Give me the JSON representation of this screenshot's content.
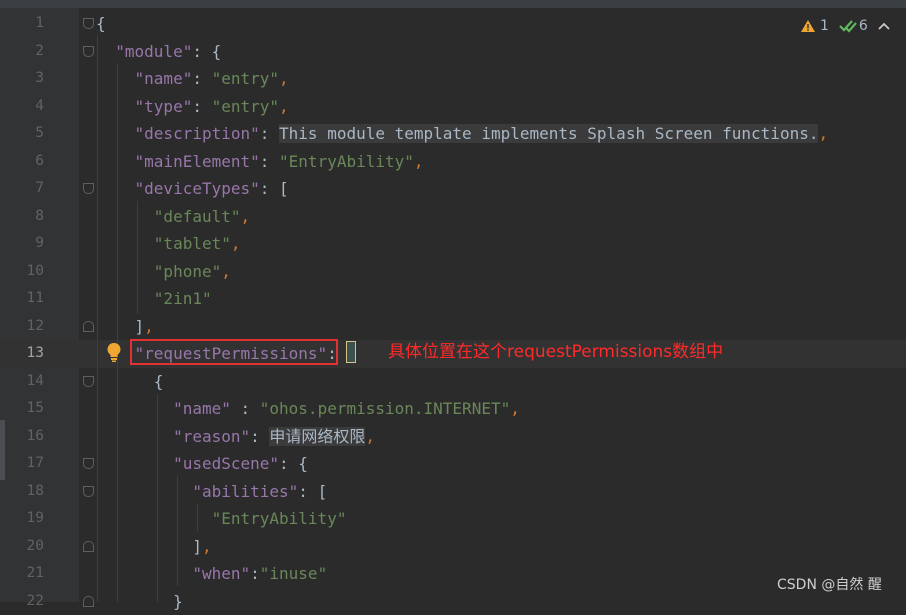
{
  "editor": {
    "current_line": 13,
    "inspections": {
      "warnings": "1",
      "checks": "6"
    },
    "lines": [
      {
        "num": "1",
        "parts": [
          {
            "t": "{",
            "c": "b"
          }
        ]
      },
      {
        "num": "2",
        "parts": [
          {
            "t": "  "
          },
          {
            "t": "\"module\"",
            "c": "k"
          },
          {
            "t": ": {",
            "c": "b"
          }
        ]
      },
      {
        "num": "3",
        "parts": [
          {
            "t": "    "
          },
          {
            "t": "\"name\"",
            "c": "k"
          },
          {
            "t": ": ",
            "c": "b"
          },
          {
            "t": "\"entry\"",
            "c": "s"
          },
          {
            "t": ",",
            "c": "p"
          }
        ]
      },
      {
        "num": "4",
        "parts": [
          {
            "t": "    "
          },
          {
            "t": "\"type\"",
            "c": "k"
          },
          {
            "t": ": ",
            "c": "b"
          },
          {
            "t": "\"entry\"",
            "c": "s"
          },
          {
            "t": ",",
            "c": "p"
          }
        ]
      },
      {
        "num": "5",
        "parts": [
          {
            "t": "    "
          },
          {
            "t": "\"description\"",
            "c": "k"
          },
          {
            "t": ": ",
            "c": "b"
          },
          {
            "t": "This module template implements Splash Screen functions.",
            "c": "b hl"
          },
          {
            "t": ",",
            "c": "p"
          }
        ]
      },
      {
        "num": "6",
        "parts": [
          {
            "t": "    "
          },
          {
            "t": "\"mainElement\"",
            "c": "k"
          },
          {
            "t": ": ",
            "c": "b"
          },
          {
            "t": "\"EntryAbility\"",
            "c": "s"
          },
          {
            "t": ",",
            "c": "p"
          }
        ]
      },
      {
        "num": "7",
        "parts": [
          {
            "t": "    "
          },
          {
            "t": "\"deviceTypes\"",
            "c": "k"
          },
          {
            "t": ": [",
            "c": "b"
          }
        ]
      },
      {
        "num": "8",
        "parts": [
          {
            "t": "      "
          },
          {
            "t": "\"default\"",
            "c": "s"
          },
          {
            "t": ",",
            "c": "p"
          }
        ]
      },
      {
        "num": "9",
        "parts": [
          {
            "t": "      "
          },
          {
            "t": "\"tablet\"",
            "c": "s"
          },
          {
            "t": ",",
            "c": "p"
          }
        ]
      },
      {
        "num": "10",
        "parts": [
          {
            "t": "      "
          },
          {
            "t": "\"phone\"",
            "c": "s"
          },
          {
            "t": ",",
            "c": "p"
          }
        ]
      },
      {
        "num": "11",
        "parts": [
          {
            "t": "      "
          },
          {
            "t": "\"2in1\"",
            "c": "s"
          }
        ]
      },
      {
        "num": "12",
        "parts": [
          {
            "t": "    "
          },
          {
            "t": "]",
            "c": "b"
          },
          {
            "t": ",",
            "c": "p"
          }
        ]
      },
      {
        "num": "13",
        "parts": [
          {
            "t": "    "
          },
          {
            "t": "\"requestPermissions\"",
            "c": "k"
          },
          {
            "t": ":",
            "c": "b"
          }
        ]
      },
      {
        "num": "14",
        "parts": [
          {
            "t": "      "
          },
          {
            "t": "{",
            "c": "b"
          }
        ]
      },
      {
        "num": "15",
        "parts": [
          {
            "t": "        "
          },
          {
            "t": "\"name\"",
            "c": "k"
          },
          {
            "t": " : ",
            "c": "b"
          },
          {
            "t": "\"ohos.permission.INTERNET\"",
            "c": "s"
          },
          {
            "t": ",",
            "c": "p"
          }
        ]
      },
      {
        "num": "16",
        "parts": [
          {
            "t": "        "
          },
          {
            "t": "\"reason\"",
            "c": "k"
          },
          {
            "t": ": ",
            "c": "b"
          },
          {
            "t": "申请网络权限",
            "c": "b hl"
          },
          {
            "t": ",",
            "c": "p"
          }
        ]
      },
      {
        "num": "17",
        "parts": [
          {
            "t": "        "
          },
          {
            "t": "\"usedScene\"",
            "c": "k"
          },
          {
            "t": ": {",
            "c": "b"
          }
        ]
      },
      {
        "num": "18",
        "parts": [
          {
            "t": "          "
          },
          {
            "t": "\"abilities\"",
            "c": "k"
          },
          {
            "t": ": [",
            "c": "b"
          }
        ]
      },
      {
        "num": "19",
        "parts": [
          {
            "t": "            "
          },
          {
            "t": "\"EntryAbility\"",
            "c": "s"
          }
        ]
      },
      {
        "num": "20",
        "parts": [
          {
            "t": "          "
          },
          {
            "t": "]",
            "c": "b"
          },
          {
            "t": ",",
            "c": "p"
          }
        ]
      },
      {
        "num": "21",
        "parts": [
          {
            "t": "          "
          },
          {
            "t": "\"when\"",
            "c": "k"
          },
          {
            "t": ":",
            "c": "b"
          },
          {
            "t": "\"inuse\"",
            "c": "s"
          }
        ]
      },
      {
        "num": "22",
        "parts": [
          {
            "t": "        "
          },
          {
            "t": "}",
            "c": "b"
          }
        ]
      }
    ]
  },
  "annotation": {
    "text": "具体位置在这个requestPermissions数组中",
    "color": "#ff2a2a"
  },
  "watermark": "CSDN @自然 醒",
  "colors": {
    "background": "#2b2b2b",
    "key": "#9876aa",
    "string": "#6a8759",
    "punct": "#cc7832",
    "highlight_box": "#e23232"
  }
}
